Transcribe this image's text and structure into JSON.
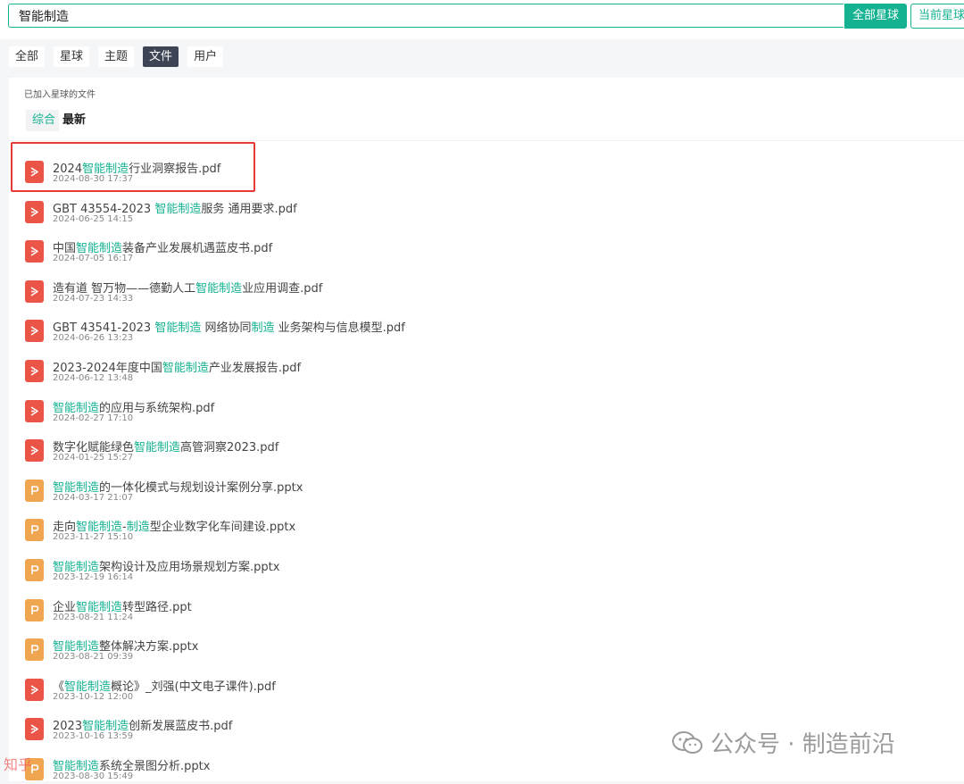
{
  "search": {
    "value": "智能制造",
    "btn_all": "全部星球",
    "btn_current": "当前星球"
  },
  "tabs": [
    "全部",
    "星球",
    "主题",
    "文件",
    "用户"
  ],
  "section_title": "已加入星球的文件",
  "subtabs": {
    "selected": "综合",
    "other": "最新"
  },
  "files": [
    {
      "type": "pdf",
      "parts": [
        [
          "2024",
          0
        ],
        [
          "智能制造",
          1
        ],
        [
          "行业洞察报告.pdf",
          0
        ]
      ],
      "date": "2024-08-30 17:37"
    },
    {
      "type": "pdf",
      "parts": [
        [
          "GBT 43554-2023 ",
          0
        ],
        [
          "智能制造",
          1
        ],
        [
          "服务 通用要求.pdf",
          0
        ]
      ],
      "date": "2024-06-25 14:15"
    },
    {
      "type": "pdf",
      "parts": [
        [
          "中国",
          0
        ],
        [
          "智能制造",
          1
        ],
        [
          "装备产业发展机遇蓝皮书.pdf",
          0
        ]
      ],
      "date": "2024-07-05 16:17"
    },
    {
      "type": "pdf",
      "parts": [
        [
          "造有道 智万物——德勤人工",
          0
        ],
        [
          "智能制造",
          1
        ],
        [
          "业应用调查.pdf",
          0
        ]
      ],
      "date": "2024-07-23 14:33"
    },
    {
      "type": "pdf",
      "parts": [
        [
          "GBT 43541-2023 ",
          0
        ],
        [
          "智能制造",
          1
        ],
        [
          " 网络协同",
          0
        ],
        [
          "制造",
          1
        ],
        [
          " 业务架构与信息模型.pdf",
          0
        ]
      ],
      "date": "2024-06-26 13:23"
    },
    {
      "type": "pdf",
      "parts": [
        [
          "2023-2024年度中国",
          0
        ],
        [
          "智能制造",
          1
        ],
        [
          "产业发展报告.pdf",
          0
        ]
      ],
      "date": "2024-06-12 13:48"
    },
    {
      "type": "pdf",
      "parts": [
        [
          "智能制造",
          1
        ],
        [
          "的应用与系统架构.pdf",
          0
        ]
      ],
      "date": "2024-02-27 17:10"
    },
    {
      "type": "pdf",
      "parts": [
        [
          "数字化赋能绿色",
          0
        ],
        [
          "智能制造",
          1
        ],
        [
          "高管洞察2023.pdf",
          0
        ]
      ],
      "date": "2024-01-25 15:27"
    },
    {
      "type": "ppt",
      "parts": [
        [
          "智能制造",
          1
        ],
        [
          "的一体化模式与规划设计案例分享.pptx",
          0
        ]
      ],
      "date": "2024-03-17 21:07"
    },
    {
      "type": "ppt",
      "parts": [
        [
          "走向",
          0
        ],
        [
          "智能制造",
          1
        ],
        [
          "-",
          0
        ],
        [
          "制造",
          1
        ],
        [
          "型企业数字化车间建设.pptx",
          0
        ]
      ],
      "date": "2023-11-27 15:10"
    },
    {
      "type": "ppt",
      "parts": [
        [
          "智能制造",
          1
        ],
        [
          "架构设计及应用场景规划方案.pptx",
          0
        ]
      ],
      "date": "2023-12-19 16:14"
    },
    {
      "type": "ppt",
      "parts": [
        [
          "企业",
          0
        ],
        [
          "智能制造",
          1
        ],
        [
          "转型路径.ppt",
          0
        ]
      ],
      "date": "2023-08-21 11:24"
    },
    {
      "type": "ppt",
      "parts": [
        [
          "智能制造",
          1
        ],
        [
          "整体解决方案.pptx",
          0
        ]
      ],
      "date": "2023-08-21 09:39"
    },
    {
      "type": "pdf",
      "parts": [
        [
          "《",
          0
        ],
        [
          "智能制造",
          1
        ],
        [
          "概论》_刘强(中文电子课件).pdf",
          0
        ]
      ],
      "date": "2023-10-12 12:00"
    },
    {
      "type": "pdf",
      "parts": [
        [
          "2023",
          0
        ],
        [
          "智能制造",
          1
        ],
        [
          "创新发展蓝皮书.pdf",
          0
        ]
      ],
      "date": "2023-10-16 13:59"
    },
    {
      "type": "ppt",
      "parts": [
        [
          "智能制造",
          1
        ],
        [
          "系统全景图分析.pptx",
          0
        ]
      ],
      "date": "2023-08-30 15:49"
    }
  ],
  "watermark": "公众号 · 制造前沿",
  "corner_logo": "知乎"
}
